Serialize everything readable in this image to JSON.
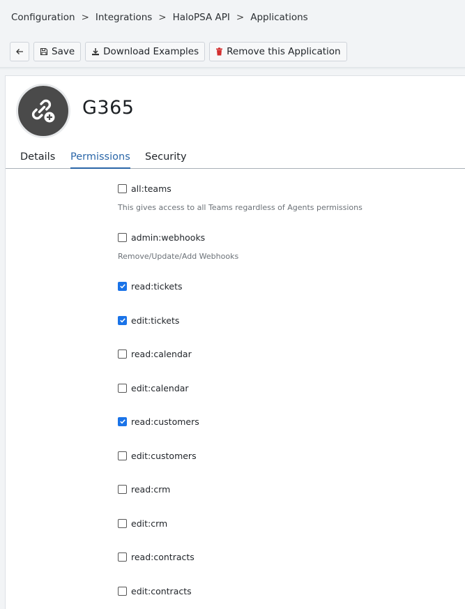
{
  "breadcrumb": {
    "items": [
      "Configuration",
      "Integrations",
      "HaloPSA API",
      "Applications"
    ],
    "separator": ">"
  },
  "toolbar": {
    "back_icon": "arrow-left-icon",
    "save_label": "Save",
    "download_label": "Download Examples",
    "remove_label": "Remove this Application",
    "remove_icon_color": "#d32f2f"
  },
  "application": {
    "name": "G365",
    "avatar_icon": "link-add-icon"
  },
  "tabs": [
    {
      "label": "Details",
      "active": false
    },
    {
      "label": "Permissions",
      "active": true
    },
    {
      "label": "Security",
      "active": false
    }
  ],
  "permissions": [
    {
      "label": "all:teams",
      "checked": false,
      "description": "This gives access to all Teams regardless of Agents permissions"
    },
    {
      "label": "admin:webhooks",
      "checked": false,
      "description": "Remove/Update/Add Webhooks"
    },
    {
      "label": "read:tickets",
      "checked": true
    },
    {
      "label": "edit:tickets",
      "checked": true
    },
    {
      "label": "read:calendar",
      "checked": false
    },
    {
      "label": "edit:calendar",
      "checked": false
    },
    {
      "label": "read:customers",
      "checked": true
    },
    {
      "label": "edit:customers",
      "checked": false
    },
    {
      "label": "read:crm",
      "checked": false
    },
    {
      "label": "edit:crm",
      "checked": false
    },
    {
      "label": "read:contracts",
      "checked": false
    },
    {
      "label": "edit:contracts",
      "checked": false
    }
  ]
}
